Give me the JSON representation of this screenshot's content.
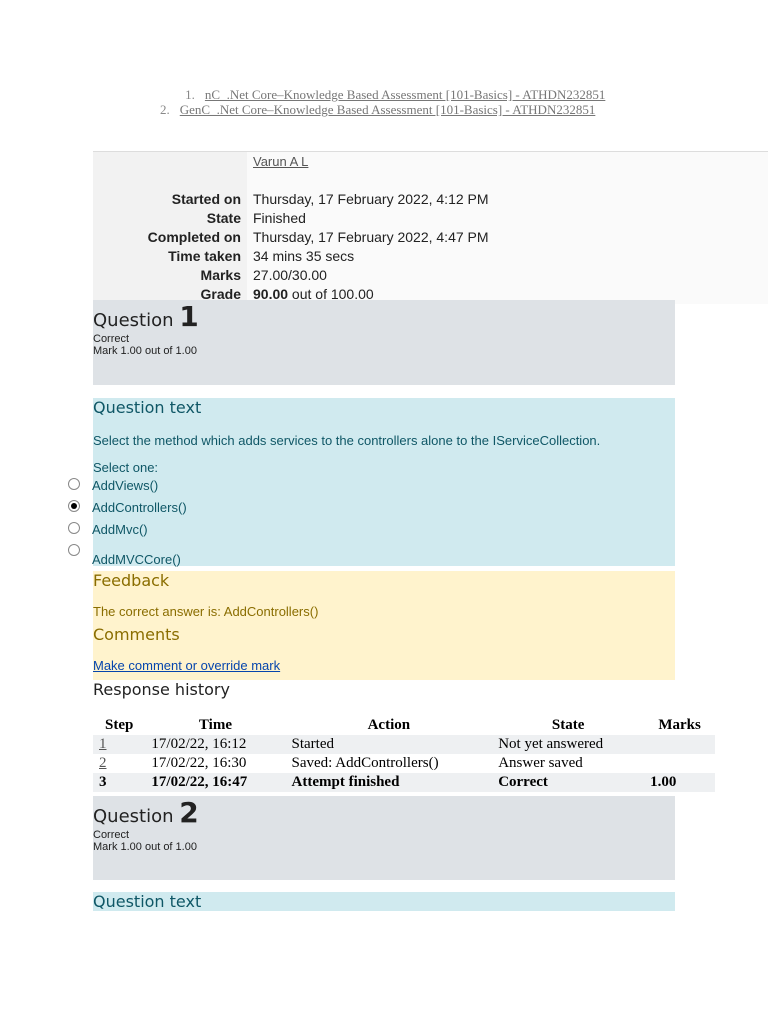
{
  "links": [
    {
      "num": "1.",
      "text": "nC_.Net Core–Knowledge Based Assessment [101-Basics] - ATHDN232851"
    },
    {
      "num": "2.",
      "text": "GenC_.Net Core–Knowledge Based Assessment [101-Basics] - ATHDN232851"
    }
  ],
  "summary": {
    "user": "Varun A L",
    "rows": [
      {
        "k": "Started on",
        "v": "Thursday, 17 February 2022, 4:12 PM"
      },
      {
        "k": "State",
        "v": "Finished"
      },
      {
        "k": "Completed on",
        "v": "Thursday, 17 February 2022, 4:47 PM"
      },
      {
        "k": "Time taken",
        "v": "34 mins 35 secs"
      },
      {
        "k": "Marks",
        "v": "27.00/30.00"
      }
    ],
    "grade_label": "Grade",
    "grade_value": "90.00",
    "grade_suffix": " out of 100.00"
  },
  "q1": {
    "label": "Question ",
    "num": "1",
    "status": "Correct",
    "mark": "Mark 1.00 out of 1.00",
    "text_heading": "Question text",
    "text": "Select the method which adds services to the controllers alone to the IServiceCollection.",
    "select_one": "Select one:",
    "options": [
      "AddViews()",
      "AddControllers()",
      "AddMvc()",
      "AddMVCCore()"
    ],
    "feedback_heading": "Feedback",
    "feedback": "The correct answer is: AddControllers()",
    "comments_heading": "Comments",
    "comment_link": "Make comment or override mark"
  },
  "history": {
    "title": "Response history",
    "headers": [
      "Step",
      "Time",
      "Action",
      "State",
      "Marks"
    ],
    "rows": [
      [
        "1",
        "17/02/22, 16:12",
        "Started",
        "Not yet answered",
        ""
      ],
      [
        "2",
        "17/02/22, 16:30",
        "Saved: AddControllers()",
        "Answer saved",
        ""
      ],
      [
        "3",
        "17/02/22, 16:47",
        "Attempt finished",
        "Correct",
        "1.00"
      ]
    ]
  },
  "q2": {
    "label": "Question ",
    "num": "2",
    "status": "Correct",
    "mark": "Mark 1.00 out of 1.00",
    "text_heading": "Question text"
  }
}
